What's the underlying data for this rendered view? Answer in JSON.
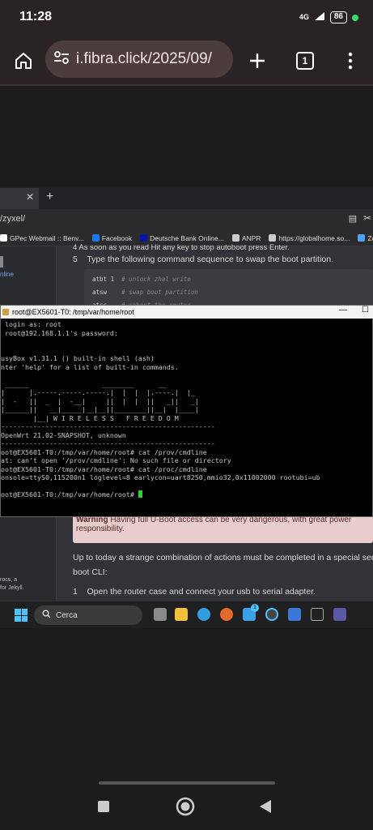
{
  "status": {
    "time": "11:28",
    "network": "4G",
    "battery": "86"
  },
  "browser": {
    "url": "i.fibra.click/2025/09/",
    "tab_count": "1"
  },
  "edge": {
    "address": "/zyxel/",
    "bookmarks": [
      {
        "label": "GPec Webmail :: Benv...",
        "color": "#ffffff"
      },
      {
        "label": "Facebook",
        "color": "#1877f2"
      },
      {
        "label": "Deutsche Bank Online...",
        "color": "#0018a8"
      },
      {
        "label": "ANPR",
        "color": "#cccccc"
      },
      {
        "label": "https://globalhome.so...",
        "color": "#cccccc"
      },
      {
        "label": "Zcs Azzurro Portal",
        "color": "#4aa3ff"
      }
    ]
  },
  "doc": {
    "line_top": "4   As soon as you read  Hit any key to stop autoboot  press Enter.",
    "step5_num": "5",
    "step5_text": "Type the following command sequence to swap the boot partition.",
    "code": [
      {
        "cmd": "atbt 1",
        "comment": "# unlock zhal write"
      },
      {
        "cmd": "atsw",
        "comment": "# swap boot partition"
      },
      {
        "cmd": "atsc",
        "comment": "# reboot the router"
      }
    ],
    "sidebar_link": "nline",
    "warning_title": "Warning",
    "warning_text": "Having full U-Boot access can be very dangerous, with great power",
    "warning_text2": "responsibility.",
    "para1": "Up to today a strange combination of actions must be completed in a special seque",
    "para2": "boot CLI:",
    "step1_num": "1",
    "step1_text": "Open the router case and connect your usb to serial adapter.",
    "side_foot1": "rocs, a",
    "side_foot2": "for Jekyll."
  },
  "putty": {
    "title": "root@EX5601-T0: /tmp/var/home/root",
    "lines": [
      " login as: root",
      " root@192.168.1.1's password:",
      "",
      "",
      "usyBox v1.31.1 () built-in shell (ash)",
      "nter 'help' for a list of built-in commands.",
      "",
      " ______                  ________      __",
      "|      |.-----.-----.-----.|  |  |  |.----.|  |_",
      "|  -   ||  _  |  -__|     ||  |  |  ||   _||   _|",
      "|______||   __|_____|__|__||________||__|  |____|",
      "        |__| W I R E L E S S   F R E E D O M",
      "-----------------------------------------------------",
      "OpenWrt 21.02-SNAPSHOT, unknown",
      "-----------------------------------------------------",
      "oot@EX5601-T0:/tmp/var/home/root# cat /prov/cmdline",
      "at: can't open '/prov/cmdline': No such file or directory",
      "oot@EX5601-T0:/tmp/var/home/root# cat /proc/cmdline",
      "onsole=ttyS0,115200n1 loglevel=8 earlycon=uart8250,mmio32,0x11002000 rootubi=ub",
      "",
      "oot@EX5601-T0:/tmp/var/home/root# "
    ]
  },
  "taskbar": {
    "search_label": "Cerca",
    "badge": "1"
  }
}
